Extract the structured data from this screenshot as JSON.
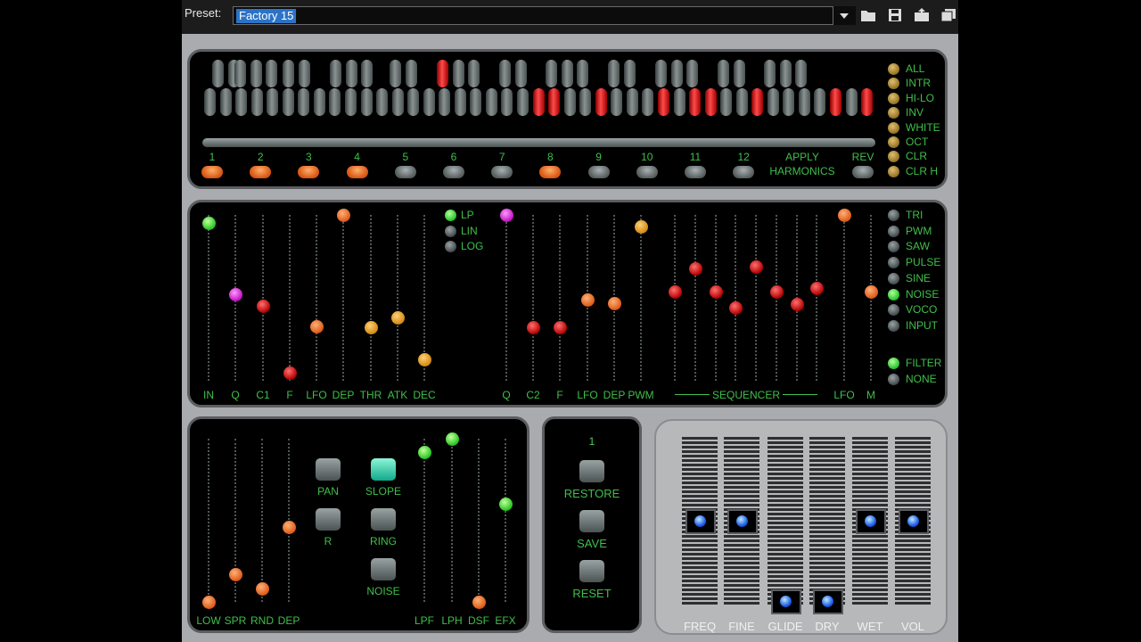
{
  "preset": {
    "label": "Preset:",
    "value": "Factory 15"
  },
  "toolbar": {
    "icons": [
      "dropdown-arrow-icon",
      "folder-icon",
      "save-icon",
      "export-icon",
      "copy-icon"
    ]
  },
  "harmonics": {
    "upper_on": [
      12
    ],
    "lower_on": [
      22,
      23,
      26,
      30,
      32,
      33,
      36,
      41,
      43
    ],
    "numbers": [
      "1",
      "2",
      "3",
      "4",
      "5",
      "6",
      "7",
      "8",
      "9",
      "10",
      "11",
      "12"
    ],
    "numbers_on": [
      0,
      1,
      2,
      3,
      7
    ],
    "apply_label": "APPLY",
    "harmonics_label": "HARMONICS",
    "rev_label": "REV",
    "side_buttons": [
      "ALL",
      "INTR",
      "HI-LO",
      "INV",
      "WHITE",
      "OCT",
      "CLR",
      "CLR H"
    ]
  },
  "filter_section": {
    "sliders": [
      {
        "label": "IN",
        "value": 0.95,
        "color": "green"
      },
      {
        "label": "Q",
        "value": 0.52,
        "color": "mag"
      },
      {
        "label": "C1",
        "value": 0.45,
        "color": "red"
      },
      {
        "label": "F",
        "value": 0.05,
        "color": "red"
      },
      {
        "label": "LFO",
        "value": 0.33,
        "color": "orange"
      },
      {
        "label": "DEP",
        "value": 1.0,
        "color": "orange"
      },
      {
        "label": "THR",
        "value": 0.32,
        "color": "amber"
      },
      {
        "label": "ATK",
        "value": 0.38,
        "color": "amber"
      },
      {
        "label": "DEC",
        "value": 0.13,
        "color": "amber"
      }
    ],
    "mode_options": [
      "LP",
      "LIN",
      "LOG"
    ],
    "mode_selected": "LP"
  },
  "osc_section": {
    "sliders": [
      {
        "label": "Q",
        "value": 1.0,
        "color": "mag"
      },
      {
        "label": "C2",
        "value": 0.32,
        "color": "red"
      },
      {
        "label": "F",
        "value": 0.32,
        "color": "red"
      },
      {
        "label": "LFO",
        "value": 0.49,
        "color": "orange"
      },
      {
        "label": "DEP",
        "value": 0.47,
        "color": "orange"
      },
      {
        "label": "PWM",
        "value": 0.93,
        "color": "amber"
      }
    ],
    "sequencer_label": "SEQUENCER",
    "sequencer": [
      0.54,
      0.68,
      0.54,
      0.44,
      0.69,
      0.54,
      0.46,
      0.56
    ],
    "lfo": {
      "label": "LFO",
      "value": 1.0,
      "color": "orange"
    },
    "m": {
      "label": "M",
      "value": 0.54,
      "color": "orange"
    },
    "waveforms": [
      "TRI",
      "PWM",
      "SAW",
      "PULSE",
      "SINE",
      "NOISE",
      "VOCO",
      "INPUT"
    ],
    "waveform_selected": "NOISE",
    "filter_options": [
      "FILTER",
      "NONE"
    ],
    "filter_selected": "FILTER"
  },
  "mod_section": {
    "sliders_left": [
      {
        "label": "LOW",
        "value": 0.0,
        "color": "orange"
      },
      {
        "label": "SPR",
        "value": 0.17,
        "color": "orange"
      },
      {
        "label": "RND",
        "value": 0.08,
        "color": "orange"
      },
      {
        "label": "DEP",
        "value": 0.46,
        "color": "orange"
      }
    ],
    "buttons": [
      {
        "label": "PAN",
        "on": false
      },
      {
        "label": "SLOPE",
        "on": true
      },
      {
        "label": "R",
        "on": false
      },
      {
        "label": "RING",
        "on": false
      },
      {
        "label": "NOISE",
        "on": false
      }
    ],
    "sliders_right": [
      {
        "label": "LPF",
        "value": 0.92,
        "color": "green"
      },
      {
        "label": "LPH",
        "value": 1.0,
        "color": "green"
      },
      {
        "label": "DSF",
        "value": 0.0,
        "color": "orange"
      },
      {
        "label": "EFX",
        "value": 0.6,
        "color": "green"
      }
    ]
  },
  "memory": {
    "slot": "1",
    "restore": "RESTORE",
    "save": "SAVE",
    "reset": "RESET"
  },
  "output": {
    "labels": [
      "FREQ",
      "FINE",
      "GLIDE",
      "DRY",
      "WET",
      "VOL"
    ],
    "values": [
      0.5,
      0.5,
      0.0,
      0.0,
      0.5,
      0.5
    ]
  }
}
